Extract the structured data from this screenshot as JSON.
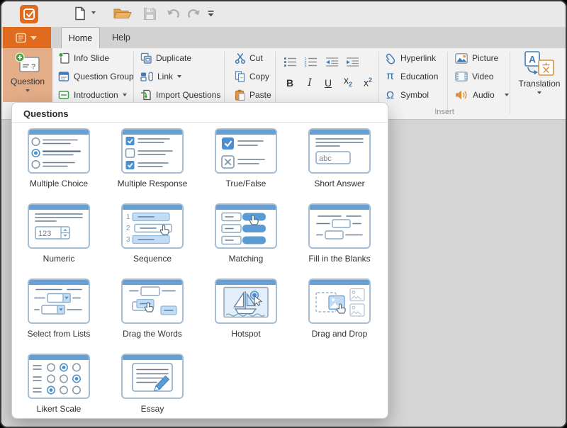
{
  "tabs": {
    "home": "Home",
    "help": "Help"
  },
  "ribbon": {
    "question_label": "Question",
    "info_slide": "Info Slide",
    "question_group": "Question Group",
    "introduction": "Introduction",
    "duplicate": "Duplicate",
    "link": "Link",
    "import_questions": "Import Questions",
    "cut": "Cut",
    "copy": "Copy",
    "paste": "Paste",
    "format": {
      "bold": "B",
      "italic": "I",
      "underline": "U",
      "sub": [
        "x",
        "2"
      ],
      "sup": [
        "x",
        "2"
      ]
    },
    "hyperlink": "Hyperlink",
    "education": "Education",
    "symbol": "Symbol",
    "picture": "Picture",
    "video": "Video",
    "audio": "Audio",
    "translation": "Translation",
    "group_insert": "Insert",
    "glyphs": {
      "education_pi": "π",
      "symbol_omega": "Ω",
      "translation_a": "A",
      "translation_cjk": "文"
    }
  },
  "panel": {
    "title": "Questions",
    "items": [
      "Multiple Choice",
      "Multiple Response",
      "True/False",
      "Short Answer",
      "Numeric",
      "Sequence",
      "Matching",
      "Fill in the Blanks",
      "Select from Lists",
      "Drag the Words",
      "Hotspot",
      "Drag and Drop",
      "Likert Scale",
      "Essay"
    ],
    "art_text": {
      "short_answer": "abc",
      "numeric": "123",
      "seq1": "1",
      "seq2": "2",
      "seq3": "3"
    }
  },
  "colors": {
    "accent_orange": "#e06a1e",
    "pressed_button": "#e3ad87",
    "icon_blue": "#3e7cb8",
    "card_border": "#a6bfd6",
    "card_header_blue": "#64a0d6",
    "chip_light_blue": "#c3dcf3",
    "chip_solid_blue": "#5b9bd5",
    "canvas_gray": "#d5d5d5"
  }
}
